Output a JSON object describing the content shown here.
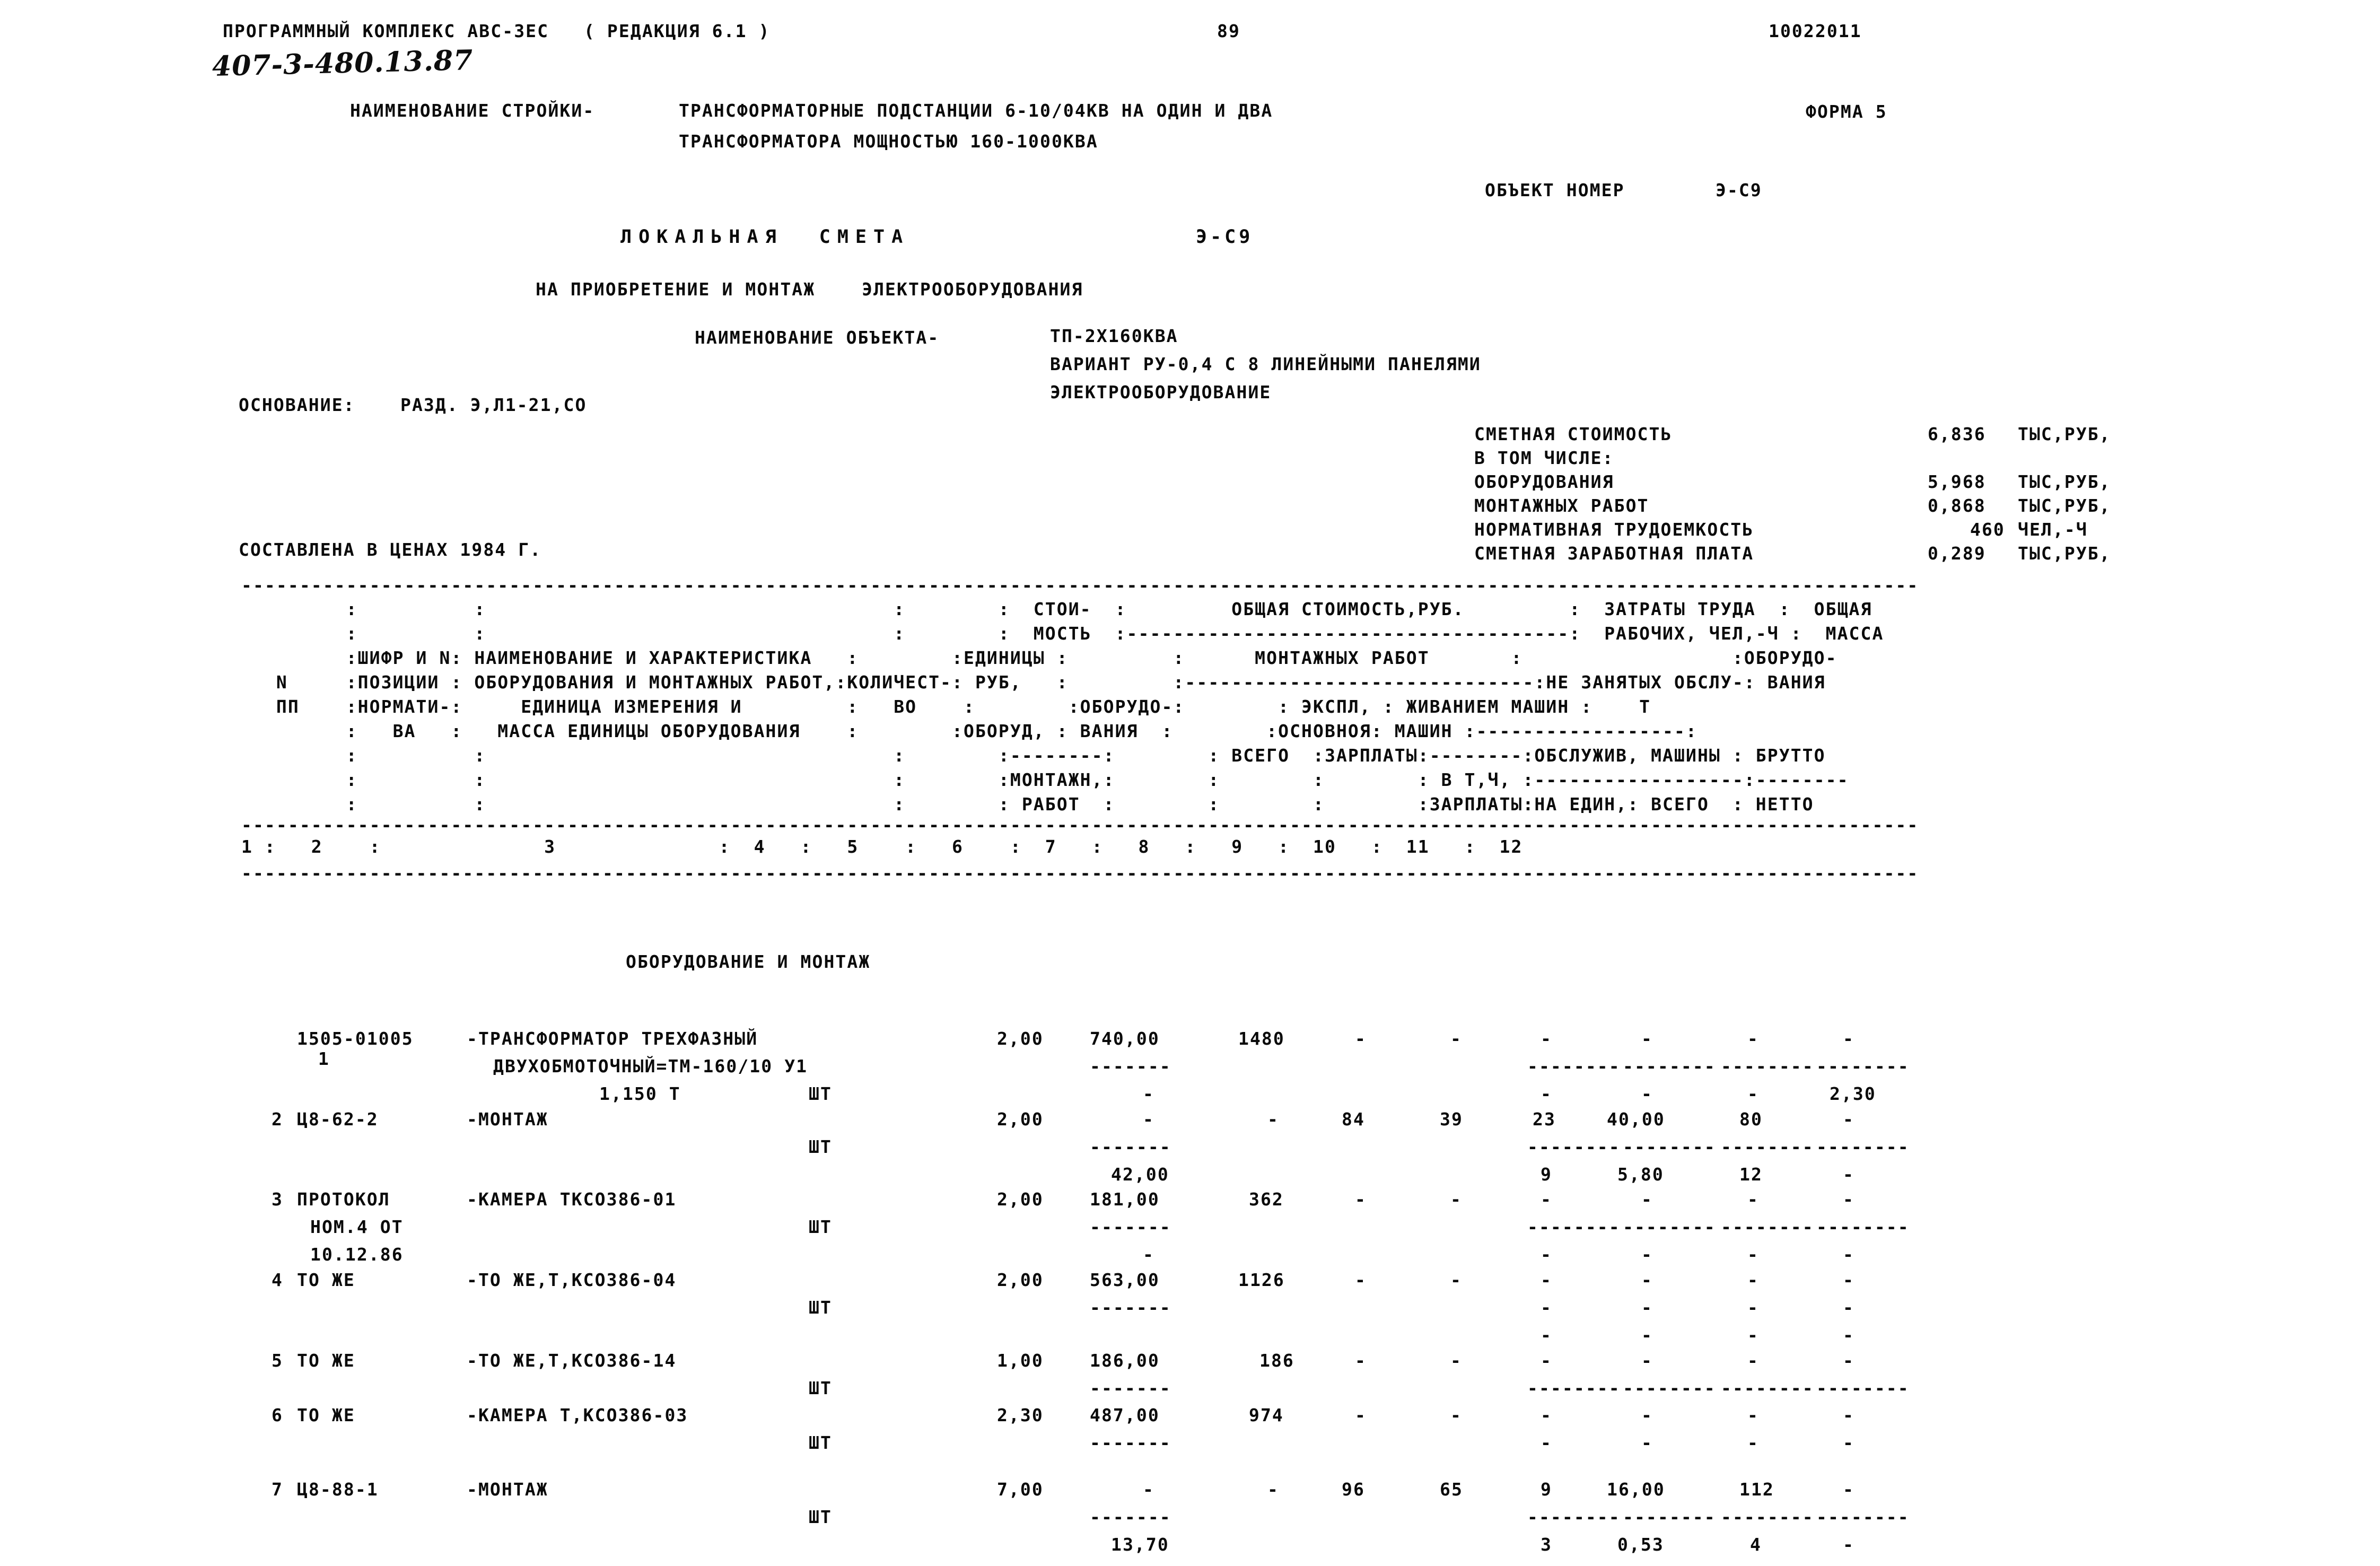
{
  "page": {
    "program_title": "ПРОГРАММНЫЙ КОМПЛЕКС АВС-ЗЕС   ( РЕДАКЦИЯ 6.1 )",
    "page_number": "89",
    "doc_code": "10022011",
    "handwritten_code": "407-3-480.13.87",
    "form_label": "ФОРМА 5"
  },
  "construction": {
    "label": "НАИМЕНОВАНИЕ СТРОЙКИ-",
    "line1": "ТРАНСФОРМАТОРНЫЕ ПОДСТАНЦИИ 6-10/04КВ НА ОДИН И ДВА",
    "line2": "ТРАНСФОРМАТОРА МОЩНОСТЬЮ 160-1000КВА"
  },
  "object": {
    "number_label": "ОБЪЕКТ НОМЕР",
    "number_value": "Э-С9",
    "estimate_title": "ЛОКАЛЬНАЯ  СМЕТА",
    "estimate_code": "Э-С9",
    "subtitle": "НА ПРИОБРЕТЕНИЕ И МОНТАЖ    ЭЛЕКТРООБОРУДОВАНИЯ",
    "name_label": "НАИМЕНОВАНИЕ ОБЪЕКТА-",
    "name_line1": "ТП-2Х160КВА",
    "name_line2": "ВАРИАНТ РУ-0,4 С 8 ЛИНЕЙНЫМИ ПАНЕЛЯМИ",
    "name_line3": "ЭЛЕКТРООБОРУДОВАНИЕ"
  },
  "basis": {
    "label": "ОСНОВАНИЕ:",
    "value": "РАЗД. Э,Л1-21,СО"
  },
  "prices_note": "СОСТАВЛЕНА В ЦЕНАХ 1984 Г.",
  "summary": [
    {
      "label": "СМЕТНАЯ СТОИМОСТЬ",
      "value": "6,836",
      "unit": "ТЫС,РУБ,"
    },
    {
      "label": "В ТОМ ЧИСЛЕ:",
      "value": "",
      "unit": ""
    },
    {
      "label": "ОБОРУДОВАНИЯ",
      "value": "5,968",
      "unit": "ТЫС,РУБ,"
    },
    {
      "label": "МОНТАЖНЫХ РАБОТ",
      "value": "0,868",
      "unit": "ТЫС,РУБ,"
    },
    {
      "label": "НОРМАТИВНАЯ ТРУДОЕМКОСТЬ",
      "value": "460",
      "unit": "ЧЕЛ,-Ч"
    },
    {
      "label": "СМЕТНАЯ ЗАРАБОТНАЯ ПЛАТА",
      "value": "0,289",
      "unit": "ТЫС,РУБ,"
    }
  ],
  "table_header": {
    "rows": [
      "         :          :                                   :        :  СТОИ-  :         ОБЩАЯ СТОИМОСТЬ,РУБ.         :  ЗАТРАТЫ ТРУДА  :  ОБЩАЯ",
      "         :          :                                   :        :  МОСТЬ  :--------------------------------------:  РАБОЧИХ, ЧЕЛ,-Ч :  МАССА",
      "         :ШИФР И N: НАИМЕНОВАНИЕ И ХАРАКТЕРИСТИКА   :        :ЕДИНИЦЫ :         :      МОНТАЖНЫХ РАБОТ       :                  :ОБОРУДО-",
      "   N     :ПОЗИЦИИ : ОБОРУДОВАНИЯ И МОНТАЖНЫХ РАБОТ,:КОЛИЧЕСТ-: РУБ,   :         :------------------------------:НЕ ЗАНЯТЫХ ОБСЛУ-: ВАНИЯ",
      "   ПП    :НОРМАТИ-:     ЕДИНИЦА ИЗМЕРЕНИЯ И         :   ВО    :        :ОБОРУДО-:        : ЭКСПЛ, : ЖИВАНИЕМ МАШИН :    Т",
      "         :   ВА   :   МАССА ЕДИНИЦЫ ОБОРУДОВАНИЯ    :        :ОБОРУД, : ВАНИЯ  :        :ОСНОВНОЯ: МАШИН :------------------:",
      "         :          :                                   :        :--------:        : ВСЕГО  :ЗАРПЛАТЫ:--------:ОБСЛУЖИВ, МАШИНЫ : БРУТТО",
      "         :          :                                   :        :МОНТАЖН,:        :        :        : В Т,Ч, :------------------:--------",
      "         :          :                                   :        : РАБОТ  :        :        :        :ЗАРПЛАТЫ:НА ЕДИН,: ВСЕГО  : НЕТТО"
    ],
    "column_numbers": "1 :   2    :              3              :  4   :   5    :   6    :  7   :   8   :   9   :  10   :  11   :  12"
  },
  "section_title": "ОБОРУДОВАНИЕ И МОНТАЖ",
  "rows": [
    {
      "n": "1",
      "code": "1505-01005",
      "name": "-ТРАНСФОРМАТОР ТРЕХФАЗНЫЙ",
      "name2": "ДВУХОБМОТОЧНЫЙ=ТМ-160/10 У1",
      "mass": "1,150 Т",
      "unit": "ШТ",
      "qty": "2,00",
      "price": "740,00",
      "equip_cost": "1480",
      "total": "-",
      "base_wage": "-",
      "mach_exp": "-",
      "mach_wage": "-",
      "per_unit": "-",
      "labor_total": "-",
      "mass_gross": "-",
      "sub_price": "-------",
      "sub_dash1": "--------",
      "sub_dash2": "--------",
      "sub_dash3": "--------",
      "sub_dash4": "--------",
      "mass_net": "2,30",
      "sub_mark": "-",
      "sub_b": "-",
      "sub_c": "-",
      "sub_d": "-"
    },
    {
      "n": "2",
      "code": "Ц8-62-2",
      "name": "-МОНТАЖ",
      "name2": "",
      "mass": "",
      "unit": "ШТ",
      "qty": "2,00",
      "price": "-",
      "equip_cost": "-",
      "total": "84",
      "base_wage": "39",
      "mach_exp": "23",
      "mach_wage": "40,00",
      "per_unit": "80",
      "labor_total": "-",
      "sub_price": "-------",
      "sub_total": "42,00",
      "sub_mach_exp": "9",
      "sub_mach_wage": "5,80",
      "sub_per_unit": "12",
      "sub_last": "-"
    },
    {
      "n": "3",
      "code": "ПРОТОКОЛ",
      "code2": "НОМ.4 ОТ",
      "code3": "10.12.86",
      "name": "-КАМЕРА ТКСО386-01",
      "unit": "ШТ",
      "qty": "2,00",
      "price": "181,00",
      "equip_cost": "362",
      "total": "-",
      "base_wage": "-",
      "mach_exp": "-",
      "mach_wage": "-",
      "per_unit": "-",
      "labor_total": "-",
      "sub_price": "-------",
      "sub_mark": "-"
    },
    {
      "n": "4",
      "code": "ТО ЖЕ",
      "name": "-ТО ЖЕ,Т,КСО386-04",
      "unit": "ШТ",
      "qty": "2,00",
      "price": "563,00",
      "equip_cost": "1126",
      "total": "-",
      "base_wage": "-",
      "mach_exp": "-",
      "mach_wage": "-",
      "per_unit": "-",
      "labor_total": "-",
      "sub_price": "-------",
      "sub_mark": "-"
    },
    {
      "n": "5",
      "code": "ТО ЖЕ",
      "name": "-ТО ЖЕ,Т,КСО386-14",
      "unit": "ШТ",
      "qty": "1,00",
      "price": "186,00",
      "equip_cost": "186",
      "total": "-",
      "base_wage": "-",
      "mach_exp": "-",
      "mach_wage": "-",
      "per_unit": "-",
      "labor_total": "-",
      "sub_price": "-------",
      "sub_mark": "-"
    },
    {
      "n": "6",
      "code": "ТО ЖЕ",
      "name": "-КАМЕРА Т,КСО386-03",
      "unit": "ШТ",
      "qty": "2,30",
      "price": "487,00",
      "equip_cost": "974",
      "total": "-",
      "base_wage": "-",
      "mach_exp": "-",
      "mach_wage": "-",
      "per_unit": "-",
      "labor_total": "-",
      "sub_price": "-------",
      "sub_mark": "-"
    },
    {
      "n": "7",
      "code": "Ц8-88-1",
      "name": "-МОНТАЖ",
      "unit": "ШТ",
      "qty": "7,00",
      "price": "-",
      "equip_cost": "-",
      "total": "96",
      "base_wage": "65",
      "mach_exp": "9",
      "mach_wage": "16,00",
      "per_unit": "112",
      "labor_total": "-",
      "sub_price": "-------",
      "sub_total": "13,70",
      "sub_mach_exp": "3",
      "sub_mach_wage": "0,53",
      "sub_per_unit": "4",
      "sub_last": "-"
    }
  ],
  "dividers": {
    "long": "------------------------------------------------------------------------------------------------------------------------------------------------"
  }
}
